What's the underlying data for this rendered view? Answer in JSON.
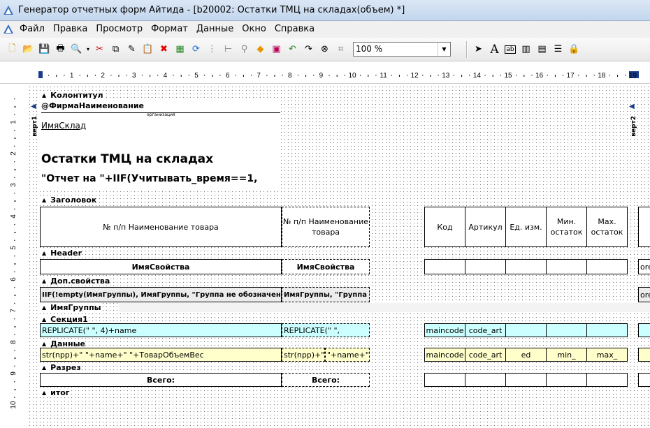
{
  "window": {
    "title": "Генератор отчетных форм Айтида - [b20002: Остатки ТМЦ на складах(объем) *]"
  },
  "menu": [
    "Файл",
    "Правка",
    "Просмотр",
    "Формат",
    "Данные",
    "Окно",
    "Справка"
  ],
  "toolbar": {
    "zoom": "100 %"
  },
  "ruler": {
    "h": [
      "1",
      "2",
      "3",
      "4",
      "5",
      "6",
      "7",
      "8",
      "9",
      "10",
      "11",
      "12",
      "13",
      "14",
      "15",
      "16",
      "17",
      "18",
      "19"
    ],
    "v": [
      "1",
      "2",
      "3",
      "4",
      "5",
      "6",
      "7",
      "8",
      "9",
      "10"
    ]
  },
  "bands": {
    "kolontitul": "Колонтитул",
    "zagolovok": "Заголовок",
    "header": "Header",
    "dopsvoistva": "Доп.свойства",
    "imyagruppy": "ИмяГруппы",
    "sekciya1": "Секция1",
    "dannye": "Данные",
    "razrez": "Разрез",
    "itog": "итог"
  },
  "side": {
    "left": "верт1",
    "right": "верт2"
  },
  "kolontitul": {
    "firm": "@ФирмаНаименование",
    "firm_caption": "организация",
    "sklad": "ИмяСклад",
    "title": "Остатки ТМЦ на складах",
    "expr": "\"Отчет на \"+IIF(Учитывать_время==1,"
  },
  "zagolovok": {
    "col1": "№ п/п Наименование товара",
    "col2": "№ п/п Наименование товара",
    "kod": "Код",
    "artikul": "Артикул",
    "ed": "Ед. изм.",
    "min": "Мин. остаток",
    "max": "Max. остаток"
  },
  "header": {
    "c1": "ИмяСвойства",
    "c2": "ИмяСвойства",
    "right": "ore"
  },
  "dop": {
    "c1": "IIF(!empty(ИмяГруппы), ИмяГруппы, \"Группа не обозначена\")",
    "c2": "ИмяГруппы, \"Группа",
    "right": "ore"
  },
  "sekciya": {
    "c1": "REPLICATE(\" \", 4)+name",
    "c2": "REPLICATE(\" \",",
    "kod": "maincode",
    "art": "code_art"
  },
  "dannye": {
    "c1": "str(npp)+\"   \"+name+\" \"+ТоварОбъемВес",
    "c2a": "str(npp)+\"",
    "c2b": "\"+name+\"",
    "kod": "maincode",
    "art": "code_art",
    "ed": "ed",
    "min": "min_",
    "max": "max_"
  },
  "razrez": {
    "c1": "Всего:",
    "c2": "Всего:"
  }
}
